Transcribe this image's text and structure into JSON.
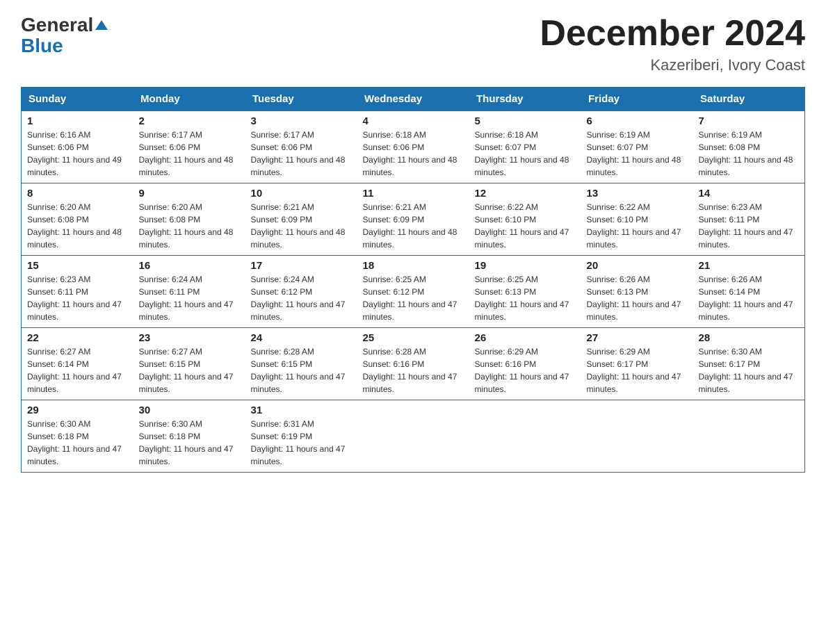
{
  "header": {
    "logo_general": "General",
    "logo_blue": "Blue",
    "title": "December 2024",
    "subtitle": "Kazeriberi, Ivory Coast"
  },
  "days_of_week": [
    "Sunday",
    "Monday",
    "Tuesday",
    "Wednesday",
    "Thursday",
    "Friday",
    "Saturday"
  ],
  "weeks": [
    [
      {
        "day": "1",
        "sunrise": "6:16 AM",
        "sunset": "6:06 PM",
        "daylight": "11 hours and 49 minutes."
      },
      {
        "day": "2",
        "sunrise": "6:17 AM",
        "sunset": "6:06 PM",
        "daylight": "11 hours and 48 minutes."
      },
      {
        "day": "3",
        "sunrise": "6:17 AM",
        "sunset": "6:06 PM",
        "daylight": "11 hours and 48 minutes."
      },
      {
        "day": "4",
        "sunrise": "6:18 AM",
        "sunset": "6:06 PM",
        "daylight": "11 hours and 48 minutes."
      },
      {
        "day": "5",
        "sunrise": "6:18 AM",
        "sunset": "6:07 PM",
        "daylight": "11 hours and 48 minutes."
      },
      {
        "day": "6",
        "sunrise": "6:19 AM",
        "sunset": "6:07 PM",
        "daylight": "11 hours and 48 minutes."
      },
      {
        "day": "7",
        "sunrise": "6:19 AM",
        "sunset": "6:08 PM",
        "daylight": "11 hours and 48 minutes."
      }
    ],
    [
      {
        "day": "8",
        "sunrise": "6:20 AM",
        "sunset": "6:08 PM",
        "daylight": "11 hours and 48 minutes."
      },
      {
        "day": "9",
        "sunrise": "6:20 AM",
        "sunset": "6:08 PM",
        "daylight": "11 hours and 48 minutes."
      },
      {
        "day": "10",
        "sunrise": "6:21 AM",
        "sunset": "6:09 PM",
        "daylight": "11 hours and 48 minutes."
      },
      {
        "day": "11",
        "sunrise": "6:21 AM",
        "sunset": "6:09 PM",
        "daylight": "11 hours and 48 minutes."
      },
      {
        "day": "12",
        "sunrise": "6:22 AM",
        "sunset": "6:10 PM",
        "daylight": "11 hours and 47 minutes."
      },
      {
        "day": "13",
        "sunrise": "6:22 AM",
        "sunset": "6:10 PM",
        "daylight": "11 hours and 47 minutes."
      },
      {
        "day": "14",
        "sunrise": "6:23 AM",
        "sunset": "6:11 PM",
        "daylight": "11 hours and 47 minutes."
      }
    ],
    [
      {
        "day": "15",
        "sunrise": "6:23 AM",
        "sunset": "6:11 PM",
        "daylight": "11 hours and 47 minutes."
      },
      {
        "day": "16",
        "sunrise": "6:24 AM",
        "sunset": "6:11 PM",
        "daylight": "11 hours and 47 minutes."
      },
      {
        "day": "17",
        "sunrise": "6:24 AM",
        "sunset": "6:12 PM",
        "daylight": "11 hours and 47 minutes."
      },
      {
        "day": "18",
        "sunrise": "6:25 AM",
        "sunset": "6:12 PM",
        "daylight": "11 hours and 47 minutes."
      },
      {
        "day": "19",
        "sunrise": "6:25 AM",
        "sunset": "6:13 PM",
        "daylight": "11 hours and 47 minutes."
      },
      {
        "day": "20",
        "sunrise": "6:26 AM",
        "sunset": "6:13 PM",
        "daylight": "11 hours and 47 minutes."
      },
      {
        "day": "21",
        "sunrise": "6:26 AM",
        "sunset": "6:14 PM",
        "daylight": "11 hours and 47 minutes."
      }
    ],
    [
      {
        "day": "22",
        "sunrise": "6:27 AM",
        "sunset": "6:14 PM",
        "daylight": "11 hours and 47 minutes."
      },
      {
        "day": "23",
        "sunrise": "6:27 AM",
        "sunset": "6:15 PM",
        "daylight": "11 hours and 47 minutes."
      },
      {
        "day": "24",
        "sunrise": "6:28 AM",
        "sunset": "6:15 PM",
        "daylight": "11 hours and 47 minutes."
      },
      {
        "day": "25",
        "sunrise": "6:28 AM",
        "sunset": "6:16 PM",
        "daylight": "11 hours and 47 minutes."
      },
      {
        "day": "26",
        "sunrise": "6:29 AM",
        "sunset": "6:16 PM",
        "daylight": "11 hours and 47 minutes."
      },
      {
        "day": "27",
        "sunrise": "6:29 AM",
        "sunset": "6:17 PM",
        "daylight": "11 hours and 47 minutes."
      },
      {
        "day": "28",
        "sunrise": "6:30 AM",
        "sunset": "6:17 PM",
        "daylight": "11 hours and 47 minutes."
      }
    ],
    [
      {
        "day": "29",
        "sunrise": "6:30 AM",
        "sunset": "6:18 PM",
        "daylight": "11 hours and 47 minutes."
      },
      {
        "day": "30",
        "sunrise": "6:30 AM",
        "sunset": "6:18 PM",
        "daylight": "11 hours and 47 minutes."
      },
      {
        "day": "31",
        "sunrise": "6:31 AM",
        "sunset": "6:19 PM",
        "daylight": "11 hours and 47 minutes."
      },
      null,
      null,
      null,
      null
    ]
  ]
}
